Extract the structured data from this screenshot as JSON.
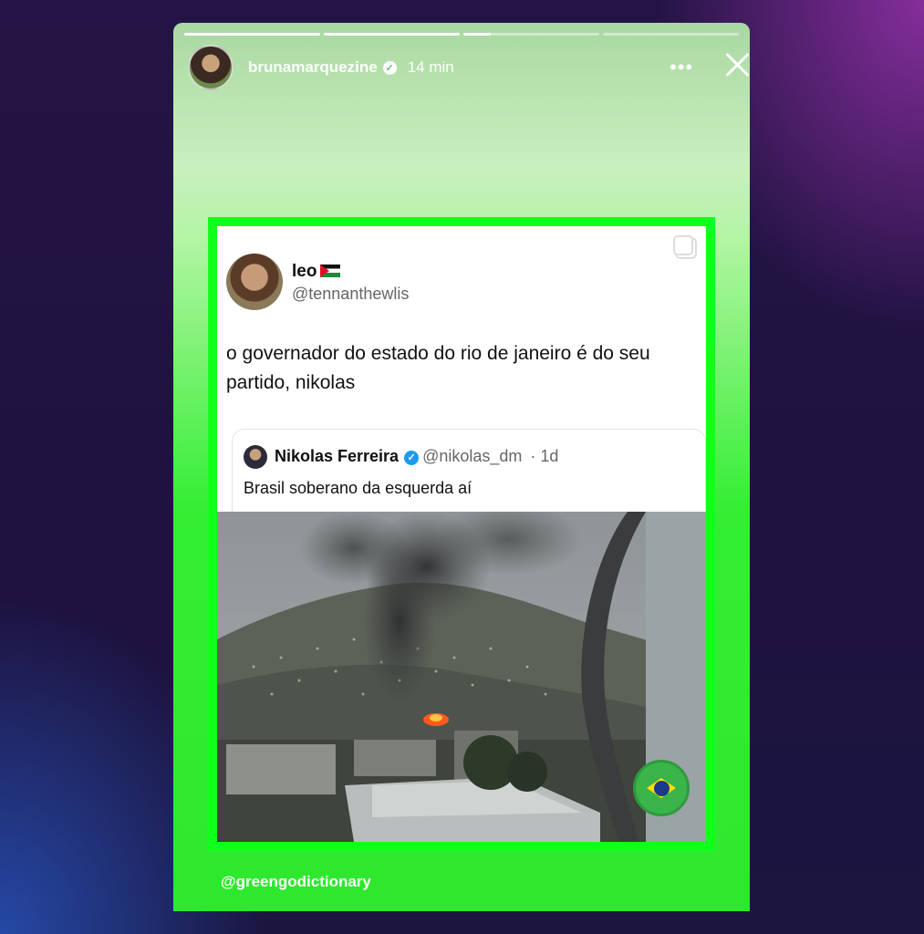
{
  "story": {
    "progress": [
      1,
      1,
      0.2,
      0,
      0
    ],
    "username": "brunamarquezine",
    "time": "14 min",
    "more_label": "•••"
  },
  "tweet": {
    "name": "leo",
    "handle": "@tennanthewlis",
    "text": "o governador do estado do rio de janeiro é do seu partido, nikolas"
  },
  "quote": {
    "name": "Nikolas Ferreira",
    "handle": "@nikolas_dm",
    "age": "· 1d",
    "text": "Brasil soberano da esquerda aí"
  },
  "watermark": "@greengodictionary",
  "colors": {
    "frame_green": "#11ff1a",
    "story_green": "#2ee82e",
    "verified_blue": "#1d9bf0"
  }
}
